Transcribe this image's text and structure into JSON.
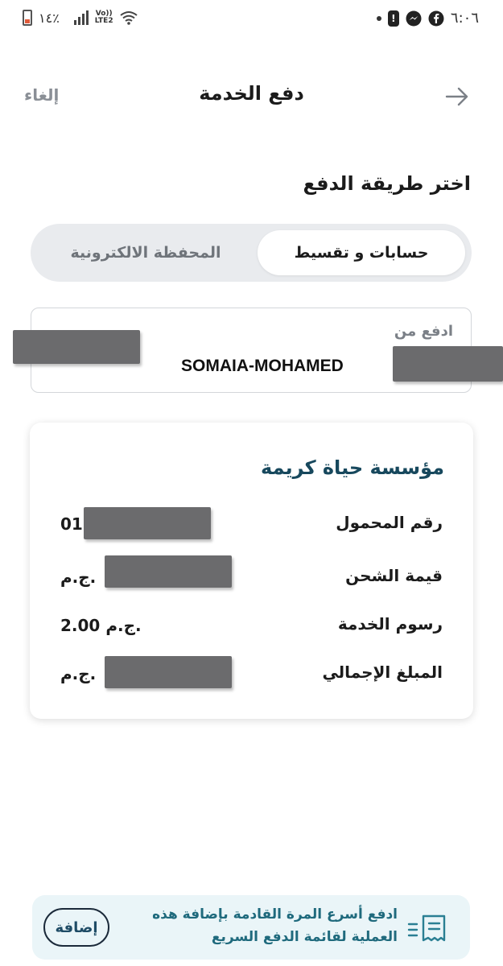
{
  "status_bar": {
    "battery_text": "١٤٪",
    "network": "LTE2",
    "volte": "Vo))",
    "time": "٦:٠٦",
    "alert_symbol": "!"
  },
  "header": {
    "title": "دفع الخدمة",
    "cancel_label": "إلغاء",
    "back_icon": "arrow-right-icon"
  },
  "payment": {
    "section_title": "اختر طريقة الدفع",
    "tabs": [
      {
        "label": "حسابات و تقسيط",
        "active": true
      },
      {
        "label": "المحفظة الالكترونية",
        "active": false
      }
    ],
    "pay_from_label": "ادفع من",
    "account_name": "SOMAIA-MOHAMED"
  },
  "summary": {
    "provider": "مؤسسة حياة كريمة",
    "rows": [
      {
        "label": "رقم المحمول",
        "value": "01"
      },
      {
        "label": "قيمة الشحن",
        "value": "ج.م."
      },
      {
        "label": "رسوم الخدمة",
        "value": "2.00 ج.م."
      },
      {
        "label": "المبلغ الإجمالي",
        "value": "ج.م."
      }
    ]
  },
  "banner": {
    "text": "ادفع أسرع المرة القادمة بإضافة هذه العملية لقائمة الدفع السريع",
    "add_label": "إضافة",
    "icon": "receipt-list-icon"
  },
  "colors": {
    "primary_text": "#1b1b1b",
    "provider": "#17485d",
    "banner_bg": "#eaf5f8",
    "banner_text": "#1f6a7d",
    "muted": "#8a8f96"
  }
}
